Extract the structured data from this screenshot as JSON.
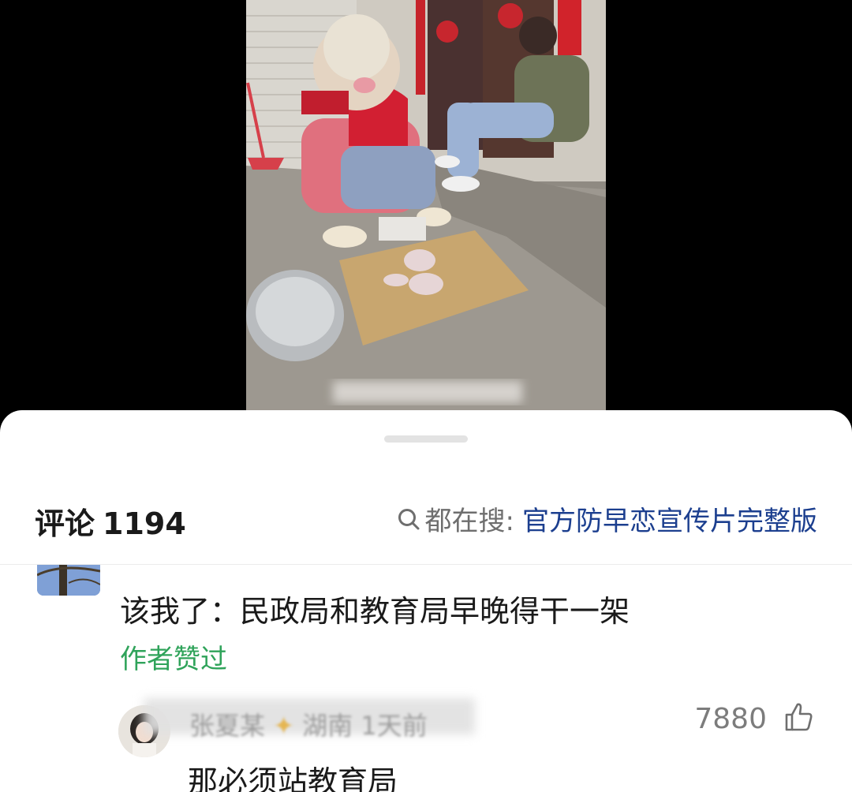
{
  "video": {
    "content": "video-frame"
  },
  "sheet": {
    "comment_label": "评论",
    "comment_count": "1194",
    "search_prefix": "都在搜:",
    "search_term": "官方防早恋宣传片完整版"
  },
  "comments": [
    {
      "text": "该我了：民政局和教育局早晚得干一架",
      "badge": "作者赞过"
    }
  ],
  "reply": {
    "username": "张夏某",
    "location": "湖南",
    "time": "1天前",
    "likes": "7880",
    "text": "那必须站教育局"
  },
  "colors": {
    "search_term": "#1c3f8f",
    "author_liked": "#2fa35a",
    "background": "#000000",
    "sheet": "#ffffff"
  },
  "icons": {
    "search": "search-icon",
    "like": "thumbs-up-icon"
  }
}
